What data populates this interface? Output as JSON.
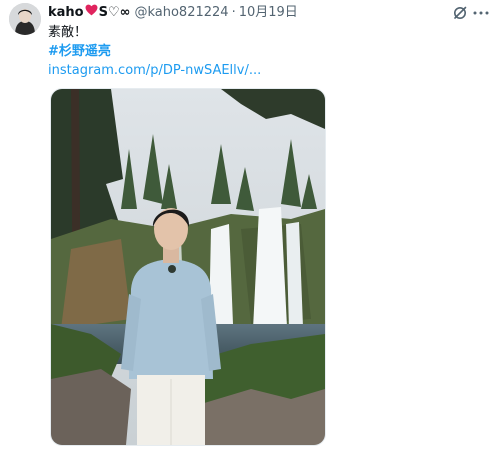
{
  "tweet": {
    "display_name": "kaho",
    "name_suffix": "S♡∞",
    "handle": "@kaho821224",
    "separator": "·",
    "date": "10月19日",
    "text": "素敵！",
    "hashtag": "#杉野遥亮",
    "link": "instagram.com/p/DP-nwSAEllv/..."
  },
  "icons": {
    "avatar": "avatar",
    "heart": "heart-icon",
    "grok": "grok-icon",
    "more": "more-icon",
    "media": "photo"
  },
  "colors": {
    "link": "#1d9bf0",
    "heart": "#e0245e",
    "secondary_text": "#536471"
  }
}
